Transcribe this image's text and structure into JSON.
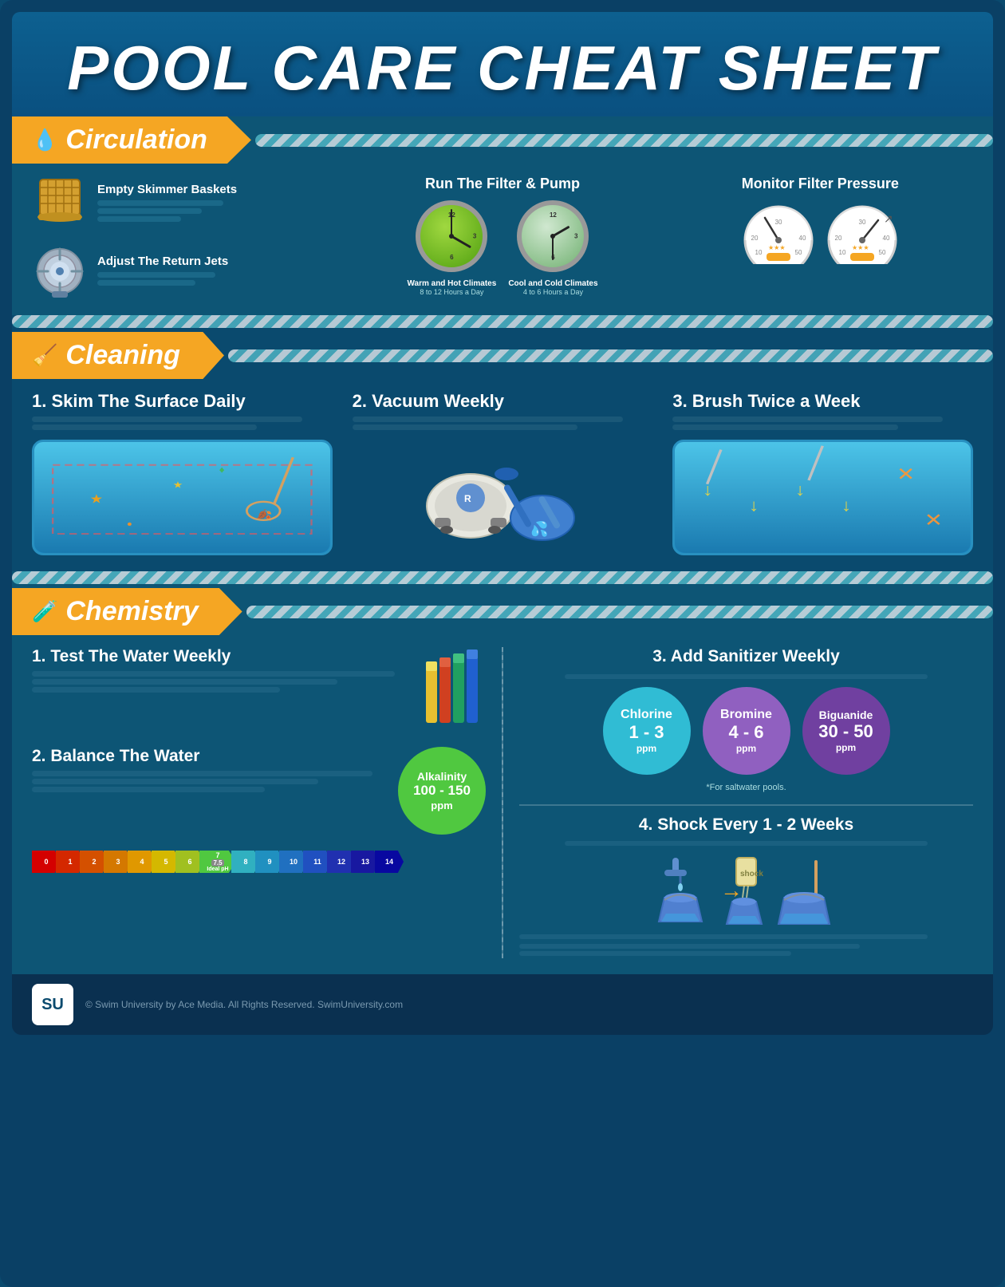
{
  "title": "POOL CARE CHEAT SHEET",
  "sections": {
    "circulation": {
      "label": "Circulation",
      "icon": "💧",
      "items": [
        {
          "name": "empty-skimmer-baskets",
          "label": "Empty Skimmer Baskets",
          "lines": [
            3
          ]
        },
        {
          "name": "adjust-return-jets",
          "label": "Adjust The Return Jets",
          "lines": [
            2
          ]
        }
      ],
      "filter_pump": {
        "title": "Run The Filter & Pump",
        "clocks": [
          {
            "label": "Warm and Hot Climates",
            "sublabel": "8 to 12 Hours a Day"
          },
          {
            "label": "Cool and Cold Climates",
            "sublabel": "4 to 6 Hours a Day"
          }
        ]
      },
      "pressure": {
        "title": "Monitor Filter Pressure"
      }
    },
    "cleaning": {
      "label": "Cleaning",
      "icon": "🧹",
      "steps": [
        {
          "number": "1.",
          "title": "Skim The Surface Daily",
          "lines": 2
        },
        {
          "number": "2.",
          "title": "Vacuum Weekly",
          "lines": 2
        },
        {
          "number": "3.",
          "title": "Brush Twice a Week",
          "lines": 2
        }
      ]
    },
    "chemistry": {
      "label": "Chemistry",
      "icon": "🧪",
      "left": {
        "step1": {
          "number": "1.",
          "title": "Test The Water Weekly",
          "lines": 3
        },
        "step2": {
          "number": "2.",
          "title": "Balance The Water",
          "lines": 3,
          "alkalinity": {
            "label": "Alkalinity",
            "value": "100 - 150",
            "unit": "ppm"
          }
        },
        "ph": {
          "values": [
            "0",
            "1",
            "2",
            "3",
            "4",
            "5",
            "6",
            "7",
            "8",
            "9",
            "10",
            "11",
            "12",
            "13",
            "14"
          ],
          "colors": [
            "#d40000",
            "#d42000",
            "#d45000",
            "#d47000",
            "#e09000",
            "#d4b000",
            "#a0c020",
            "#50c840",
            "#50c840",
            "#20a0c0",
            "#2080c0",
            "#2050c0",
            "#2030b0",
            "#1010a0",
            "#0808a0"
          ],
          "ideal": "7.5",
          "ideal_label": "Ideal pH"
        }
      },
      "right": {
        "step3": {
          "number": "3.",
          "title": "Add Sanitizer Weekly",
          "sanitizers": [
            {
              "name": "Chlorine",
              "value": "1 - 3",
              "unit": "ppm",
              "color": "#30bcd4"
            },
            {
              "name": "Bromine",
              "value": "4 - 6",
              "unit": "ppm",
              "color": "#9060c0"
            },
            {
              "name": "Biguanide",
              "value": "30 - 50",
              "unit": "ppm",
              "color": "#7040a0"
            }
          ],
          "note": "*For saltwater pools."
        },
        "step4": {
          "number": "4.",
          "title": "Shock Every 1 - 2 Weeks",
          "lines": 3
        }
      }
    }
  },
  "footer": {
    "logo": "SU",
    "copyright": "© Swim University by Ace Media. All Rights Reserved. SwimUniversity.com"
  }
}
